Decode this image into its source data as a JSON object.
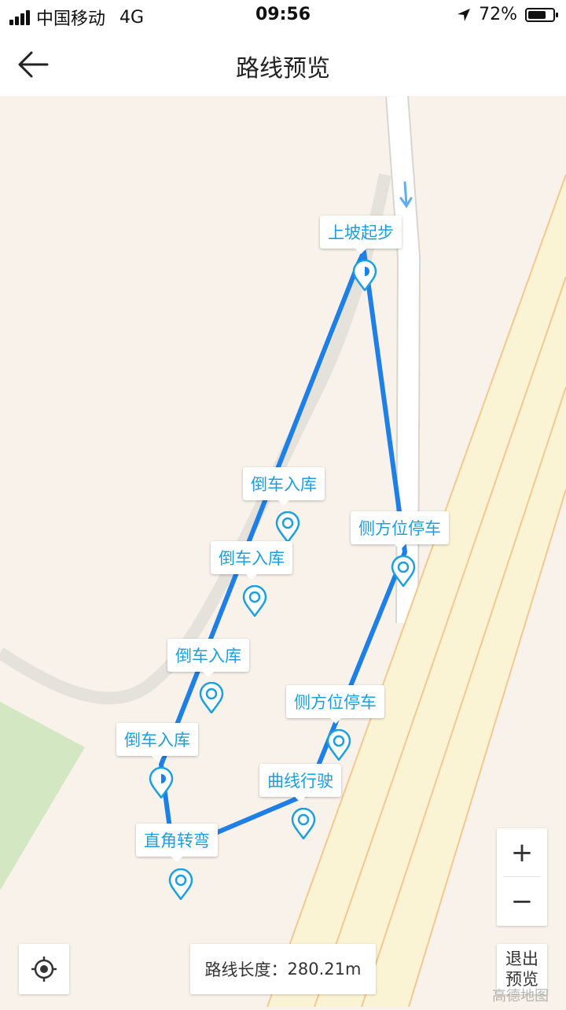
{
  "status_bar": {
    "carrier": "中国移动",
    "network": "4G",
    "time": "09:56",
    "battery": "72%",
    "battery_level": 0.72
  },
  "header": {
    "title": "路线预览"
  },
  "map": {
    "station_labels": [
      "上坡起步",
      "倒车入库",
      "倒车入库",
      "倒车入库",
      "倒车入库",
      "侧方位停车",
      "侧方位停车",
      "曲线行驶",
      "直角转弯"
    ],
    "route_color": "#1e7fe6",
    "label_color": "#1aa0e0",
    "watermark": "高德地图"
  },
  "controls": {
    "zoom_in": "+",
    "zoom_out": "−",
    "route_length_label": "路线长度：",
    "route_length_value": "280.21m",
    "exit_line1": "退出",
    "exit_line2": "预览"
  }
}
